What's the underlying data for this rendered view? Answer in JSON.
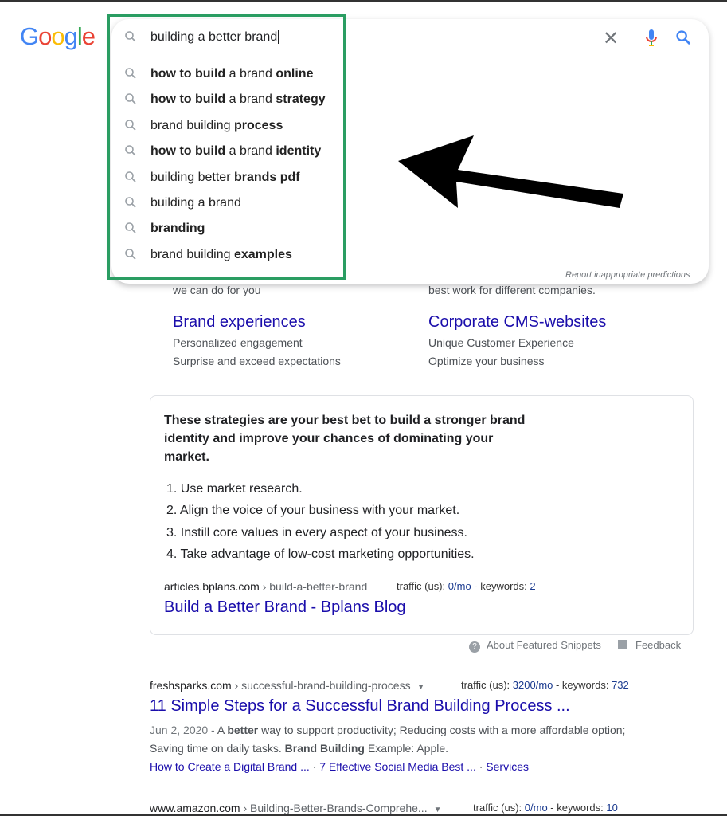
{
  "logo": {
    "text": "Google",
    "letters": [
      {
        "c": "G",
        "color": "#4285F4"
      },
      {
        "c": "o",
        "color": "#EA4335"
      },
      {
        "c": "o",
        "color": "#FBBC05"
      },
      {
        "c": "g",
        "color": "#4285F4"
      },
      {
        "c": "l",
        "color": "#34A853"
      },
      {
        "c": "e",
        "color": "#EA4335"
      }
    ]
  },
  "search": {
    "query": "building a better brand",
    "clear_icon": "close-icon",
    "mic_icon": "mic-icon",
    "search_icon": "search-icon",
    "suggestions": [
      [
        {
          "t": "how to build",
          "b": true
        },
        {
          "t": " a brand ",
          "b": false
        },
        {
          "t": "online",
          "b": true
        }
      ],
      [
        {
          "t": "how to build",
          "b": true
        },
        {
          "t": " a brand ",
          "b": false
        },
        {
          "t": "strategy",
          "b": true
        }
      ],
      [
        {
          "t": "brand building ",
          "b": false
        },
        {
          "t": "process",
          "b": true
        }
      ],
      [
        {
          "t": "how to build",
          "b": true
        },
        {
          "t": " a brand ",
          "b": false
        },
        {
          "t": "identity",
          "b": true
        }
      ],
      [
        {
          "t": "building better ",
          "b": false
        },
        {
          "t": "brands pdf",
          "b": true
        }
      ],
      [
        {
          "t": "building a brand",
          "b": false
        }
      ],
      [
        {
          "t": "branding",
          "b": true
        }
      ],
      [
        {
          "t": "brand building ",
          "b": false
        },
        {
          "t": "examples",
          "b": true
        }
      ]
    ],
    "report": "Report inappropriate predictions"
  },
  "highlight_color": "#2a9d62",
  "behind": {
    "left_tail": "we can do for you",
    "right_tail": "best work for different companies.",
    "left": {
      "title": "Brand experiences",
      "lines": [
        "Personalized engagement",
        "Surprise and exceed expectations"
      ]
    },
    "right": {
      "title": "Corporate CMS-websites",
      "lines": [
        "Unique Customer Experience",
        "Optimize your business"
      ]
    }
  },
  "snippet": {
    "lead": [
      "These strategies are your best bet to build a stronger brand",
      "identity and improve your chances of dominating your",
      "market."
    ],
    "items": [
      "1. Use market research.",
      "2. Align the voice of your business with your market.",
      "3. Instill core values in every aspect of your business.",
      "4. Take advantage of low-cost marketing opportunities."
    ],
    "domain": "articles.bplans.com",
    "path": " › build-a-better-brand",
    "traffic_label": "traffic (us): ",
    "traffic": "0/mo",
    "kw_label": " - keywords: ",
    "keywords": "2",
    "title": "Build a Better Brand - Bplans Blog",
    "about": "About Featured Snippets",
    "feedback": "Feedback"
  },
  "results": [
    {
      "domain": "freshsparks.com",
      "path": " › successful-brand-building-process",
      "traffic_label": "traffic (us): ",
      "traffic": "3200/mo",
      "kw_label": " - keywords: ",
      "keywords": "732",
      "title": "11 Simple Steps for a Successful Brand Building Process ...",
      "date": "Jun 2, 2020 - ",
      "s1a": "A ",
      "s1b": "better",
      "s1c": " way to support productivity; Reducing costs with a more affordable option;",
      "s2a": "Saving time on daily tasks. ",
      "s2b": "Brand Building",
      "s2c": " Example: Apple.",
      "sitelinks": [
        "How to Create a Digital Brand ...",
        "7 Effective Social Media Best ...",
        "Services"
      ]
    },
    {
      "domain": "www.amazon.com",
      "path": " › Building-Better-Brands-Comprehe...",
      "traffic_label": "traffic (us): ",
      "traffic": "0/mo",
      "kw_label": " - keywords: ",
      "keywords": "10"
    }
  ]
}
